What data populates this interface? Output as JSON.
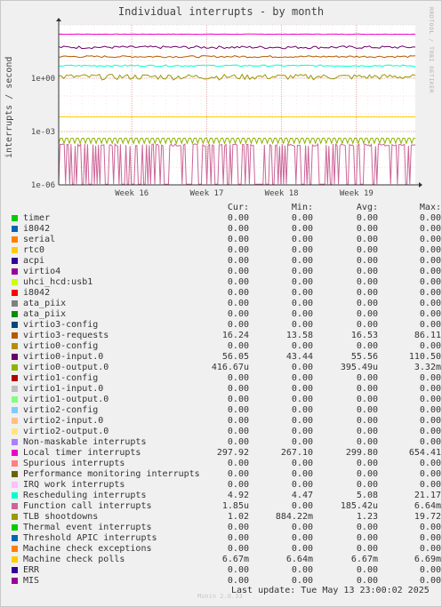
{
  "credit": "RRDTOOL / TOBI OETIKER",
  "last_update": "Last update: Tue May 13 23:00:02 2025",
  "version": "Munin 2.0.33",
  "legend_headers": [
    "Cur:",
    "Min:",
    "Avg:",
    "Max:"
  ],
  "chart_data": {
    "type": "line",
    "title": "Individual interrupts - by month",
    "xlabel": "",
    "ylabel": "interrupts / second",
    "yscale": "log",
    "ylim": [
      1e-06,
      1000
    ],
    "y_ticks": [
      "1e-06",
      "1e-03",
      "1e+00"
    ],
    "x_ticks": [
      "Week 16",
      "Week 17",
      "Week 18",
      "Week 19"
    ],
    "grid": true,
    "series": [
      {
        "name": "timer",
        "color": "#00cc00",
        "cur": "0.00",
        "min": "0.00",
        "avg": "0.00",
        "max": "0.00"
      },
      {
        "name": "i8042",
        "color": "#0066b3",
        "cur": "0.00",
        "min": "0.00",
        "avg": "0.00",
        "max": "0.00"
      },
      {
        "name": "serial",
        "color": "#ff8000",
        "cur": "0.00",
        "min": "0.00",
        "avg": "0.00",
        "max": "0.00"
      },
      {
        "name": "rtc0",
        "color": "#ffcc00",
        "cur": "0.00",
        "min": "0.00",
        "avg": "0.00",
        "max": "0.00"
      },
      {
        "name": "acpi",
        "color": "#330099",
        "cur": "0.00",
        "min": "0.00",
        "avg": "0.00",
        "max": "0.00"
      },
      {
        "name": "virtio4",
        "color": "#990099",
        "cur": "0.00",
        "min": "0.00",
        "avg": "0.00",
        "max": "0.00"
      },
      {
        "name": "uhci_hcd:usb1",
        "color": "#ccff00",
        "cur": "0.00",
        "min": "0.00",
        "avg": "0.00",
        "max": "0.00"
      },
      {
        "name": "i8042",
        "color": "#ff0000",
        "cur": "0.00",
        "min": "0.00",
        "avg": "0.00",
        "max": "0.00"
      },
      {
        "name": "ata_piix",
        "color": "#808080",
        "cur": "0.00",
        "min": "0.00",
        "avg": "0.00",
        "max": "0.00"
      },
      {
        "name": "ata_piix",
        "color": "#008f00",
        "cur": "0.00",
        "min": "0.00",
        "avg": "0.00",
        "max": "0.00"
      },
      {
        "name": "virtio3-config",
        "color": "#00487d",
        "cur": "0.00",
        "min": "0.00",
        "avg": "0.00",
        "max": "0.00"
      },
      {
        "name": "virtio3-requests",
        "color": "#b35a00",
        "cur": "16.24",
        "min": "13.58",
        "avg": "16.53",
        "max": "86.11"
      },
      {
        "name": "virtio0-config",
        "color": "#b38f00",
        "cur": "0.00",
        "min": "0.00",
        "avg": "0.00",
        "max": "0.00"
      },
      {
        "name": "virtio0-input.0",
        "color": "#6b006b",
        "cur": "56.05",
        "min": "43.44",
        "avg": "55.56",
        "max": "110.50"
      },
      {
        "name": "virtio0-output.0",
        "color": "#8fb300",
        "cur": "416.67u",
        "min": "0.00",
        "avg": "395.49u",
        "max": "3.32m"
      },
      {
        "name": "virtio1-config",
        "color": "#b30000",
        "cur": "0.00",
        "min": "0.00",
        "avg": "0.00",
        "max": "0.00"
      },
      {
        "name": "virtio1-input.0",
        "color": "#bebebe",
        "cur": "0.00",
        "min": "0.00",
        "avg": "0.00",
        "max": "0.00"
      },
      {
        "name": "virtio1-output.0",
        "color": "#80ff80",
        "cur": "0.00",
        "min": "0.00",
        "avg": "0.00",
        "max": "0.00"
      },
      {
        "name": "virtio2-config",
        "color": "#80c9ff",
        "cur": "0.00",
        "min": "0.00",
        "avg": "0.00",
        "max": "0.00"
      },
      {
        "name": "virtio2-input.0",
        "color": "#ffc080",
        "cur": "0.00",
        "min": "0.00",
        "avg": "0.00",
        "max": "0.00"
      },
      {
        "name": "virtio2-output.0",
        "color": "#ffe680",
        "cur": "0.00",
        "min": "0.00",
        "avg": "0.00",
        "max": "0.00"
      },
      {
        "name": "Non-maskable interrupts",
        "color": "#aa80ff",
        "cur": "0.00",
        "min": "0.00",
        "avg": "0.00",
        "max": "0.00"
      },
      {
        "name": "Local timer interrupts",
        "color": "#ee00cc",
        "cur": "297.92",
        "min": "267.10",
        "avg": "299.80",
        "max": "654.41"
      },
      {
        "name": "Spurious interrupts",
        "color": "#ff8080",
        "cur": "0.00",
        "min": "0.00",
        "avg": "0.00",
        "max": "0.00"
      },
      {
        "name": "Performance monitoring interrupts",
        "color": "#666600",
        "cur": "0.00",
        "min": "0.00",
        "avg": "0.00",
        "max": "0.00"
      },
      {
        "name": "IRQ work interrupts",
        "color": "#ffbfff",
        "cur": "0.00",
        "min": "0.00",
        "avg": "0.00",
        "max": "0.00"
      },
      {
        "name": "Rescheduling interrupts",
        "color": "#00ffcc",
        "cur": "4.92",
        "min": "4.47",
        "avg": "5.08",
        "max": "21.17"
      },
      {
        "name": "Function call interrupts",
        "color": "#cc6699",
        "cur": "1.85u",
        "min": "0.00",
        "avg": "185.42u",
        "max": "6.64m"
      },
      {
        "name": "TLB shootdowns",
        "color": "#999900",
        "cur": "1.02",
        "min": "884.22m",
        "avg": "1.23",
        "max": "19.72"
      },
      {
        "name": "Thermal event interrupts",
        "color": "#00cc00",
        "cur": "0.00",
        "min": "0.00",
        "avg": "0.00",
        "max": "0.00"
      },
      {
        "name": "Threshold APIC interrupts",
        "color": "#0066b3",
        "cur": "0.00",
        "min": "0.00",
        "avg": "0.00",
        "max": "0.00"
      },
      {
        "name": "Machine check exceptions",
        "color": "#ff8000",
        "cur": "0.00",
        "min": "0.00",
        "avg": "0.00",
        "max": "0.00"
      },
      {
        "name": "Machine check polls",
        "color": "#ffcc00",
        "cur": "6.67m",
        "min": "6.64m",
        "avg": "6.67m",
        "max": "6.69m"
      },
      {
        "name": "ERR",
        "color": "#330099",
        "cur": "0.00",
        "min": "0.00",
        "avg": "0.00",
        "max": "0.00"
      },
      {
        "name": "MIS",
        "color": "#990099",
        "cur": "0.00",
        "min": "0.00",
        "avg": "0.00",
        "max": "0.00"
      }
    ]
  }
}
